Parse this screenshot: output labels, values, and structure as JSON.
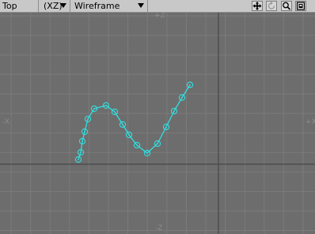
{
  "viewport": {
    "view_name": "Top",
    "axes": "(XZ)",
    "render_mode": "Wireframe",
    "labels": {
      "top": "+Z",
      "bottom": "-Z",
      "left": "-X",
      "right": "+X"
    },
    "colors": {
      "background": "#6d6d6d",
      "grid": "#7b7b7b",
      "axis": "#474747",
      "curve": "#31dfe0"
    }
  },
  "toolbar": {
    "icons": [
      "move-icon",
      "rotate-icon",
      "zoom-icon",
      "maximize-icon"
    ]
  },
  "scene": {
    "curve_points": [
      [
        99,
        201
      ],
      [
        102,
        192
      ],
      [
        104,
        178
      ],
      [
        107,
        166
      ],
      [
        111,
        150
      ],
      [
        119,
        137
      ],
      [
        134,
        133
      ],
      [
        145,
        141
      ],
      [
        155,
        157
      ],
      [
        163,
        170
      ],
      [
        173,
        183
      ],
      [
        186,
        193
      ],
      [
        199,
        181
      ],
      [
        210,
        160
      ],
      [
        220,
        140
      ],
      [
        230,
        123
      ],
      [
        240,
        107
      ]
    ]
  }
}
